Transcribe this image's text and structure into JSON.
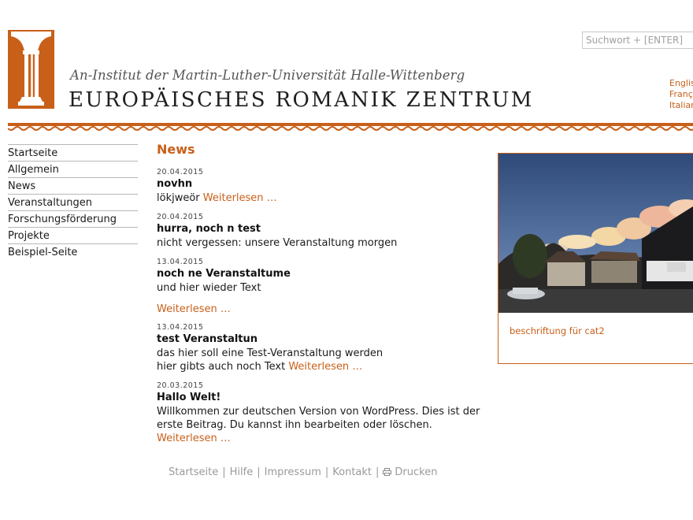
{
  "header": {
    "subtitle": "An-Institut der Martin-Luther-Universität Halle-Wittenberg",
    "title": "EUROPÄISCHES ROMANIK ZENTRUM",
    "search_placeholder": "Suchwort + [ENTER]",
    "languages": [
      "English",
      "Français",
      "Italiano"
    ]
  },
  "nav": {
    "items": [
      "Startseite",
      "Allgemein",
      "News",
      "Veranstaltungen",
      "Forschungsförderung",
      "Projekte",
      "Beispiel-Seite"
    ]
  },
  "main": {
    "page_title": "News",
    "posts": [
      {
        "date": "20.04.2015",
        "title": "novhn",
        "excerpt": "lökjweör",
        "more": "Weiterlesen …"
      },
      {
        "date": "20.04.2015",
        "title": "hurra, noch n test",
        "excerpt": "nicht vergessen: unsere Veranstaltung morgen"
      },
      {
        "date": "13.04.2015",
        "title": "noch ne Veranstaltume",
        "excerpt": "und hier wieder Text",
        "more": "Weiterlesen …"
      },
      {
        "date": "13.04.2015",
        "title": "test Veranstaltun",
        "excerpt_line1": "das hier soll eine Test-Veranstaltung werden",
        "excerpt_line2": "hier gibts auch noch Text",
        "more": "Weiterlesen …"
      },
      {
        "date": "20.03.2015",
        "title": "Hallo Welt!",
        "excerpt": "Willkommen zur deutschen Version von WordPress. Dies ist der erste Beitrag. Du kannst ihn bearbeiten oder löschen.",
        "more": "Weiterlesen …"
      }
    ]
  },
  "sidebar": {
    "image_caption": "beschriftung für cat2"
  },
  "footer": {
    "links": [
      "Startseite",
      "Hilfe",
      "Impressum",
      "Kontakt"
    ],
    "print_label": "Drucken",
    "separator": "|"
  },
  "colors": {
    "accent": "#c8601a",
    "text": "#1a1a1a",
    "footer_text": "#9a9a9a"
  }
}
